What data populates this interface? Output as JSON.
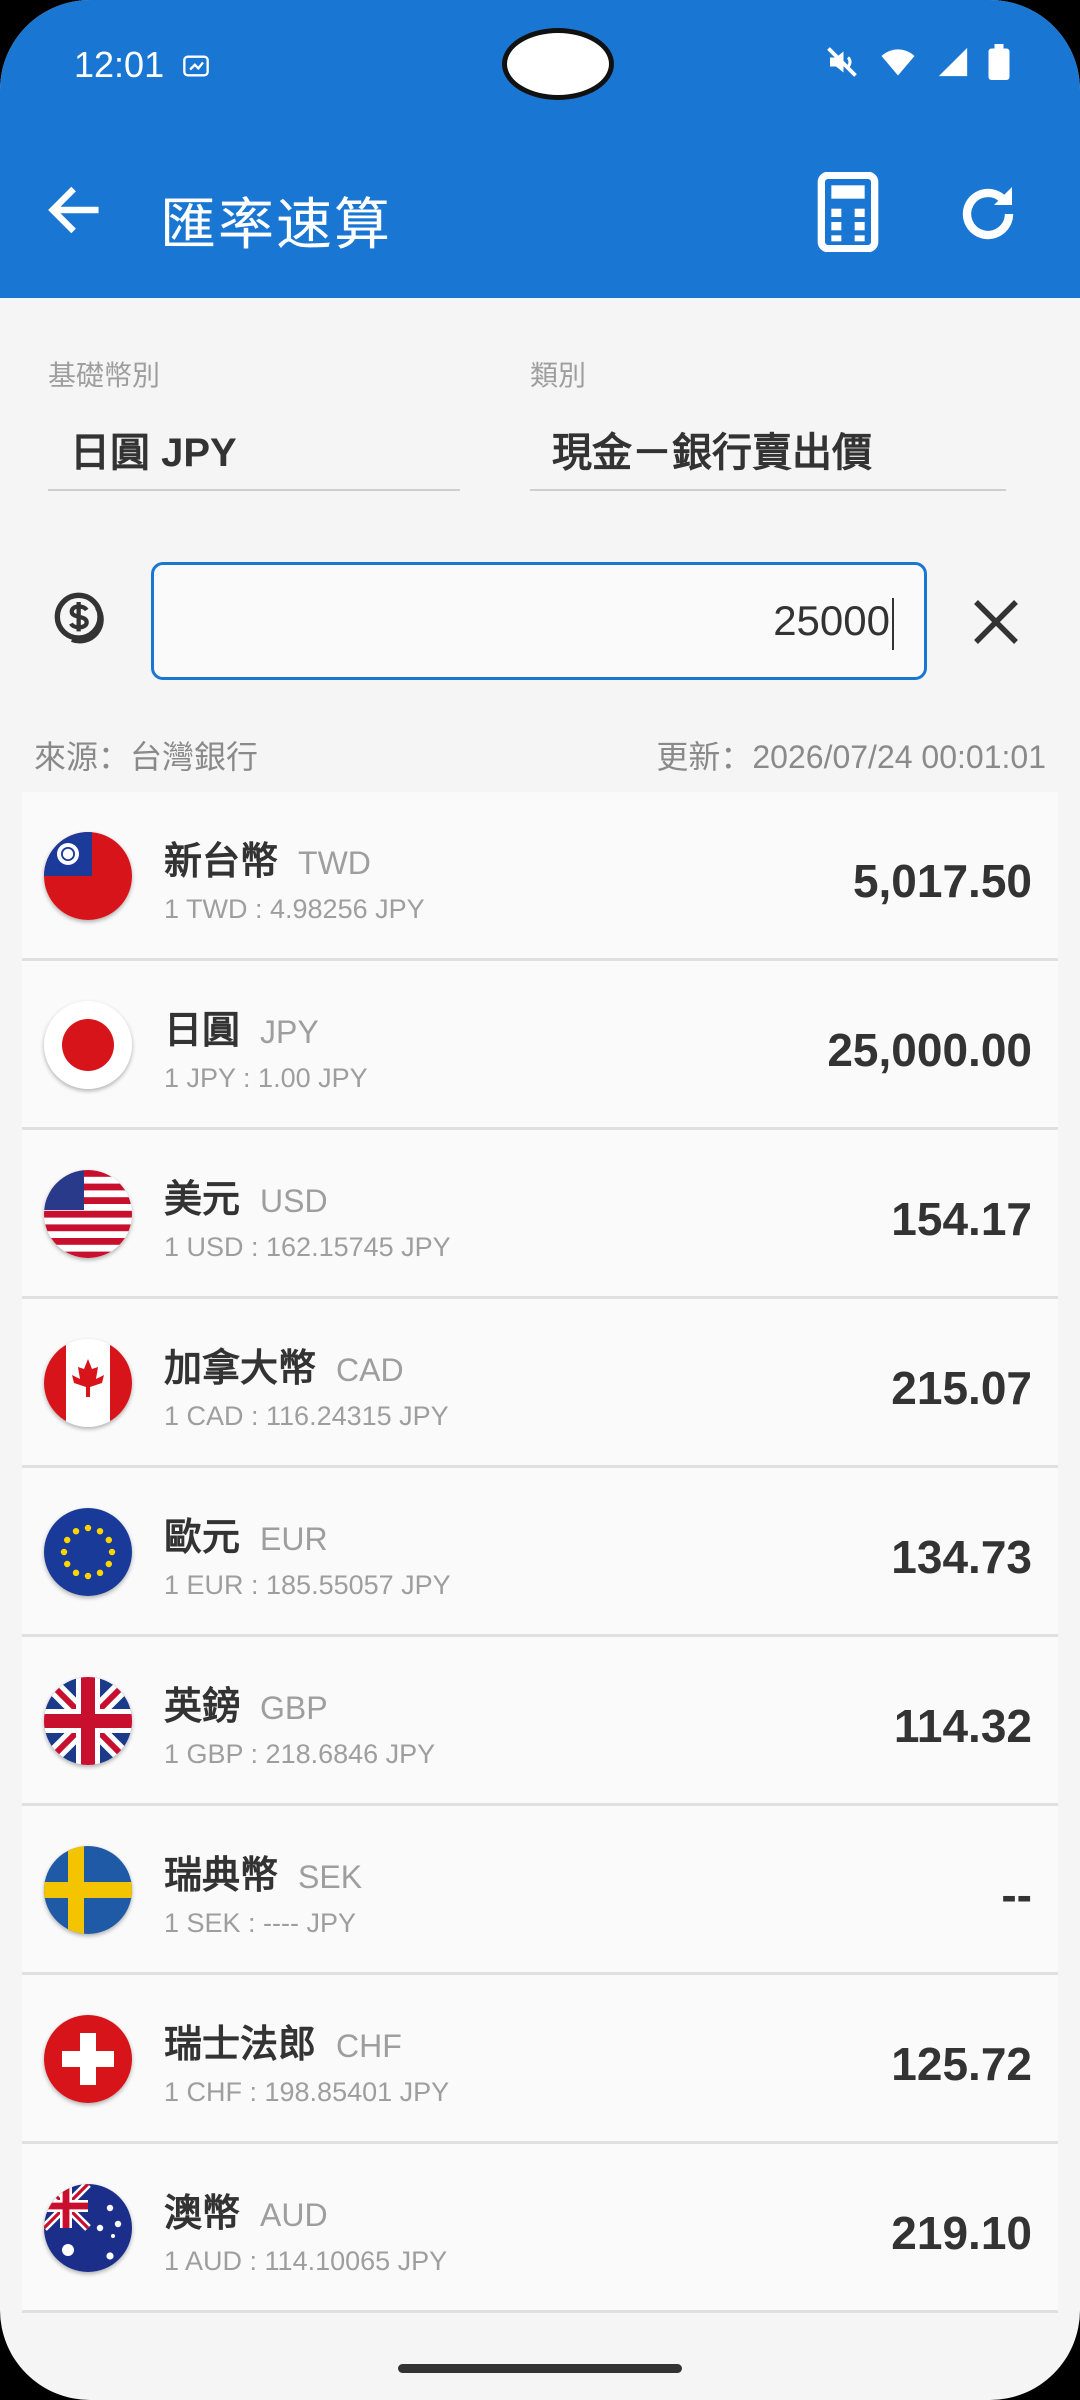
{
  "status_bar": {
    "time": "12:01"
  },
  "app_bar": {
    "title": "匯率速算"
  },
  "base_currency": {
    "label": "基礎幣別",
    "value": "日圓 JPY"
  },
  "category": {
    "label": "類別",
    "value": "現金－銀行賣出價"
  },
  "amount_input": {
    "value": "25000"
  },
  "info": {
    "source": "來源：台灣銀行",
    "updated": "更新：2026/07/24 00:01:01"
  },
  "currencies": [
    {
      "name": "新台幣",
      "code": "TWD",
      "rate": "1 TWD : 4.98256 JPY",
      "value": "5,017.50",
      "flag": "taiwan-flag-icon"
    },
    {
      "name": "日圓",
      "code": "JPY",
      "rate": "1 JPY : 1.00 JPY",
      "value": "25,000.00",
      "flag": "japan-flag-icon"
    },
    {
      "name": "美元",
      "code": "USD",
      "rate": "1 USD : 162.15745 JPY",
      "value": "154.17",
      "flag": "usa-flag-icon"
    },
    {
      "name": "加拿大幣",
      "code": "CAD",
      "rate": "1 CAD : 116.24315 JPY",
      "value": "215.07",
      "flag": "canada-flag-icon"
    },
    {
      "name": "歐元",
      "code": "EUR",
      "rate": "1 EUR : 185.55057 JPY",
      "value": "134.73",
      "flag": "eu-flag-icon"
    },
    {
      "name": "英鎊",
      "code": "GBP",
      "rate": "1 GBP : 218.6846 JPY",
      "value": "114.32",
      "flag": "uk-flag-icon"
    },
    {
      "name": "瑞典幣",
      "code": "SEK",
      "rate": "1 SEK : ---- JPY",
      "value": "--",
      "flag": "sweden-flag-icon"
    },
    {
      "name": "瑞士法郎",
      "code": "CHF",
      "rate": "1 CHF : 198.85401 JPY",
      "value": "125.72",
      "flag": "switzerland-flag-icon"
    },
    {
      "name": "澳幣",
      "code": "AUD",
      "rate": "1 AUD : 114.10065 JPY",
      "value": "219.10",
      "flag": "australia-flag-icon"
    }
  ],
  "colors": {
    "primary": "#1976d2",
    "background": "#f5f5f5",
    "row": "#fafafa"
  }
}
